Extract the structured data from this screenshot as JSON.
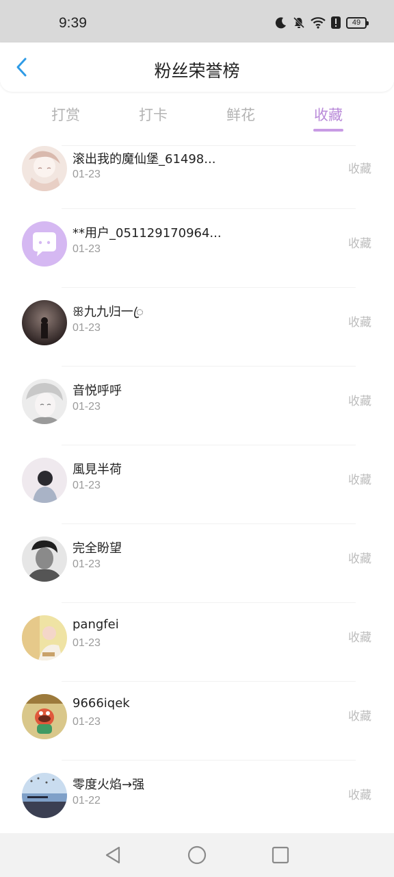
{
  "status_bar": {
    "time": "9:39",
    "battery": "49",
    "icons": [
      "moon-icon",
      "bell-off-icon",
      "wifi-icon",
      "alert-icon",
      "battery-icon"
    ]
  },
  "header": {
    "title": "粉丝荣誉榜",
    "back_icon": "chevron-left-icon",
    "accent_color": "#2f9be6"
  },
  "tabs": [
    {
      "label": "打赏",
      "active": false
    },
    {
      "label": "打卡",
      "active": false
    },
    {
      "label": "鲜花",
      "active": false
    },
    {
      "label": "收藏",
      "active": true
    }
  ],
  "active_tab_color": "#b98ad9",
  "fans": [
    {
      "name": "滚出我的魔仙堡_61498...",
      "date": "01-23",
      "action": "收藏",
      "avatar": "sketch-girl"
    },
    {
      "name": "**用户_051129170964...",
      "date": "01-23",
      "action": "收藏",
      "avatar": "default-chat"
    },
    {
      "name": "ꕥ九九归一ꦿ",
      "date": "01-23",
      "action": "收藏",
      "avatar": "dark-scene"
    },
    {
      "name": "音悦呼呼",
      "date": "01-23",
      "action": "收藏",
      "avatar": "anime-boy"
    },
    {
      "name": "風見半荷",
      "date": "01-23",
      "action": "收藏",
      "avatar": "boy-back"
    },
    {
      "name": "完全盼望",
      "date": "01-23",
      "action": "收藏",
      "avatar": "bw-man"
    },
    {
      "name": "pangfei",
      "date": "01-23",
      "action": "收藏",
      "avatar": "yellow-photo"
    },
    {
      "name": "9666iqek",
      "date": "01-23",
      "action": "收藏",
      "avatar": "cartoon"
    },
    {
      "name": "零度火焰→强",
      "date": "01-22",
      "action": "收藏",
      "avatar": "beach"
    }
  ],
  "nav_bar": {
    "buttons": [
      "back-triangle-icon",
      "home-circle-icon",
      "recents-square-icon"
    ]
  }
}
